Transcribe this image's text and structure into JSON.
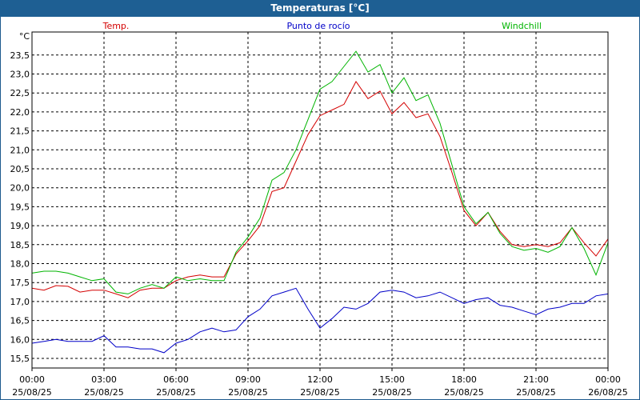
{
  "window": {
    "title": "Temperaturas [°C]"
  },
  "chart_data": {
    "type": "line",
    "title": "Temperaturas [°C]",
    "ylabel": "°C",
    "xlabel": "",
    "ylim": [
      15.3,
      24.1
    ],
    "y_ticks": [
      "15,5",
      "16,0",
      "16,5",
      "17,0",
      "17,5",
      "18,0",
      "18,5",
      "19,0",
      "19,5",
      "20,0",
      "20,5",
      "21,0",
      "21,5",
      "22,0",
      "22,5",
      "23,0",
      "23,5"
    ],
    "y_tick_values": [
      15.5,
      16.0,
      16.5,
      17.0,
      17.5,
      18.0,
      18.5,
      19.0,
      19.5,
      20.0,
      20.5,
      21.0,
      21.5,
      22.0,
      22.5,
      23.0,
      23.5
    ],
    "x_ticks": [
      {
        "time": "00:00",
        "date": "25/08/25",
        "hour": 0
      },
      {
        "time": "03:00",
        "date": "25/08/25",
        "hour": 3
      },
      {
        "time": "06:00",
        "date": "25/08/25",
        "hour": 6
      },
      {
        "time": "09:00",
        "date": "25/08/25",
        "hour": 9
      },
      {
        "time": "12:00",
        "date": "25/08/25",
        "hour": 12
      },
      {
        "time": "15:00",
        "date": "25/08/25",
        "hour": 15
      },
      {
        "time": "18:00",
        "date": "25/08/25",
        "hour": 18
      },
      {
        "time": "21:00",
        "date": "25/08/25",
        "hour": 21
      },
      {
        "time": "00:00",
        "date": "26/08/25",
        "hour": 24
      }
    ],
    "grid": true,
    "x_hours": [
      0,
      0.5,
      1,
      1.5,
      2,
      2.5,
      3,
      3.5,
      4,
      4.5,
      5,
      5.5,
      6,
      6.5,
      7,
      7.5,
      8,
      8.5,
      9,
      9.5,
      10,
      10.5,
      11,
      11.5,
      12,
      12.5,
      13,
      13.5,
      14,
      14.5,
      15,
      15.5,
      16,
      16.5,
      17,
      17.5,
      18,
      18.5,
      19,
      19.5,
      20,
      20.5,
      21,
      21.5,
      22,
      22.5,
      23,
      23.5,
      24
    ],
    "series": [
      {
        "name": "Temp.",
        "color": "#d40000",
        "values": [
          17.35,
          17.3,
          17.42,
          17.4,
          17.25,
          17.3,
          17.3,
          17.2,
          17.1,
          17.3,
          17.35,
          17.35,
          17.55,
          17.65,
          17.7,
          17.65,
          17.65,
          18.25,
          18.6,
          19.0,
          19.9,
          20.0,
          20.7,
          21.4,
          21.9,
          22.05,
          22.2,
          22.8,
          22.35,
          22.55,
          21.95,
          22.25,
          21.85,
          21.95,
          21.35,
          20.4,
          19.4,
          19.0,
          19.35,
          18.85,
          18.5,
          18.45,
          18.5,
          18.45,
          18.55,
          18.95,
          18.55,
          18.2,
          18.65
        ]
      },
      {
        "name": "Punto de rocío",
        "color": "#0000c8",
        "values": [
          15.9,
          15.95,
          16.0,
          15.95,
          15.95,
          15.95,
          16.1,
          15.8,
          15.8,
          15.75,
          15.75,
          15.65,
          15.9,
          16.0,
          16.2,
          16.3,
          16.2,
          16.25,
          16.6,
          16.8,
          17.15,
          17.25,
          17.35,
          16.8,
          16.3,
          16.55,
          16.85,
          16.8,
          16.95,
          17.25,
          17.3,
          17.25,
          17.1,
          17.15,
          17.25,
          17.1,
          16.95,
          17.05,
          17.1,
          16.9,
          16.85,
          16.75,
          16.65,
          16.8,
          16.85,
          16.95,
          16.95,
          17.15,
          17.2
        ]
      },
      {
        "name": "Windchill",
        "color": "#00b400",
        "values": [
          17.75,
          17.8,
          17.8,
          17.75,
          17.65,
          17.55,
          17.6,
          17.25,
          17.2,
          17.35,
          17.45,
          17.35,
          17.65,
          17.55,
          17.6,
          17.55,
          17.55,
          18.3,
          18.7,
          19.2,
          20.2,
          20.4,
          21.0,
          21.8,
          22.6,
          22.8,
          23.2,
          23.6,
          23.05,
          23.25,
          22.5,
          22.9,
          22.3,
          22.45,
          21.7,
          20.6,
          19.5,
          19.05,
          19.35,
          18.8,
          18.45,
          18.35,
          18.4,
          18.3,
          18.45,
          18.95,
          18.4,
          17.7,
          18.55
        ]
      }
    ]
  }
}
